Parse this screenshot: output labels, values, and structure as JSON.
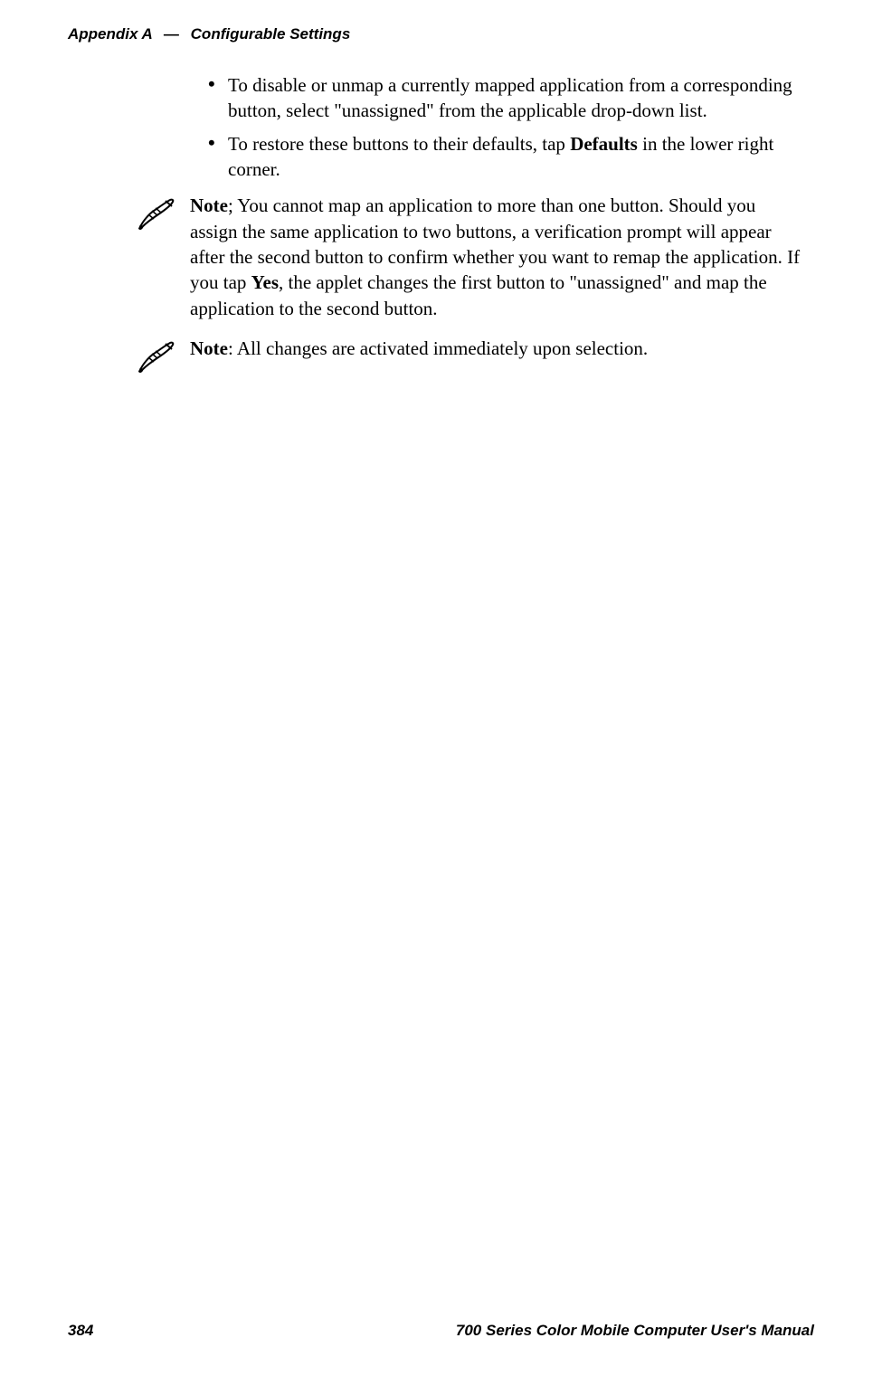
{
  "header": {
    "appendix": "Appendix A",
    "separator": "—",
    "title": "Configurable Settings"
  },
  "bullets": [
    {
      "pre": "To disable or unmap a currently mapped application from a corresponding button, select \"unassigned\" from the applicable drop-down list."
    },
    {
      "pre": "To restore these buttons to their defaults, tap ",
      "bold": "Defaults",
      "post": " in the lower right corner."
    }
  ],
  "notes": [
    {
      "label": "Note",
      "sep": "; ",
      "body_pre": "You cannot map an application to more than one button. Should you assign the same application to two buttons, a verification prompt will appear after the second button to confirm whether you want to remap the application. If you tap ",
      "bold": "Yes",
      "body_post": ", the applet changes the first button to \"unassigned\" and map the application to the second button."
    },
    {
      "label": "Note",
      "sep": ": ",
      "body_pre": "All changes are activated immediately upon selection.",
      "bold": "",
      "body_post": ""
    }
  ],
  "footer": {
    "page": "384",
    "manual": "700 Series Color Mobile Computer User's Manual"
  }
}
